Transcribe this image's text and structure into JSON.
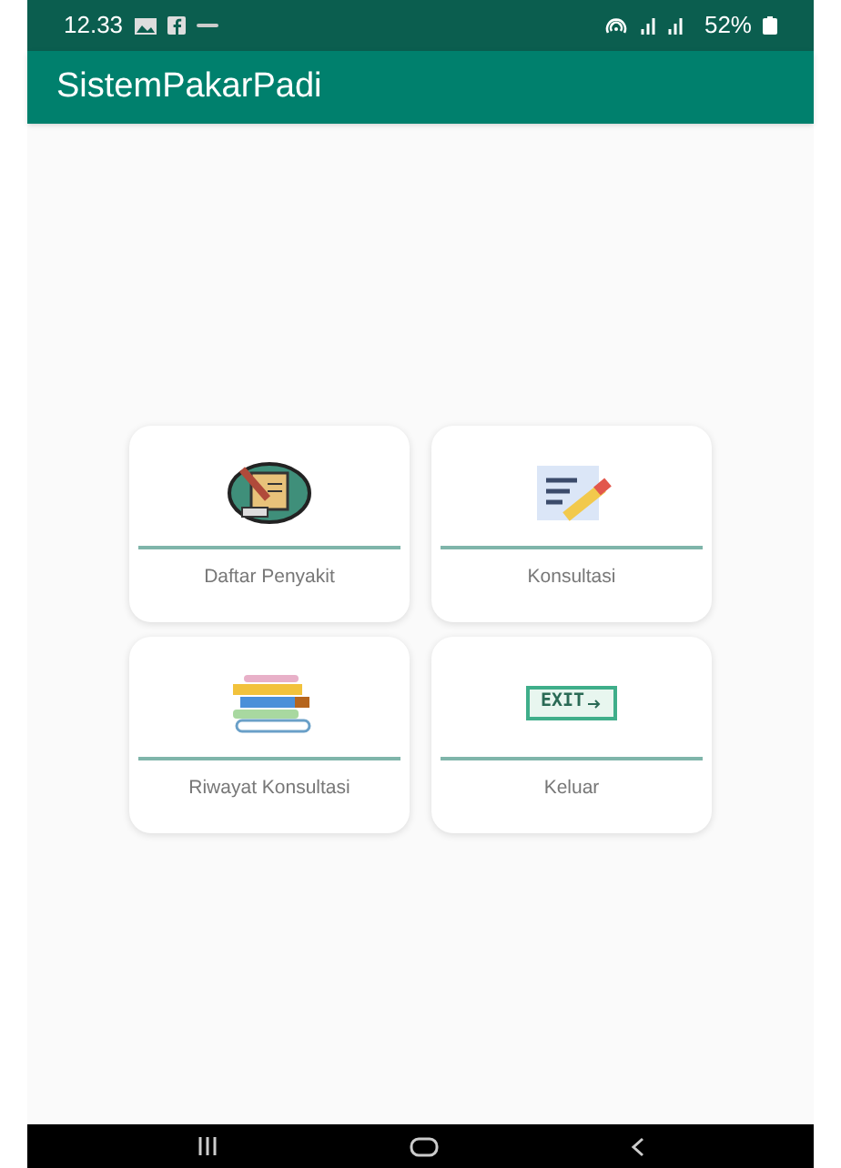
{
  "status_bar": {
    "time": "12.33",
    "battery": "52%"
  },
  "app_bar": {
    "title": "SistemPakarPadi"
  },
  "menu": [
    {
      "label": "Daftar Penyakit",
      "kind": "disease-list"
    },
    {
      "label": "Konsultasi",
      "kind": "notes"
    },
    {
      "label": "Riwayat Konsultasi",
      "kind": "books"
    },
    {
      "label": "Keluar",
      "kind": "exit"
    }
  ],
  "exit_sign": "EXIT"
}
